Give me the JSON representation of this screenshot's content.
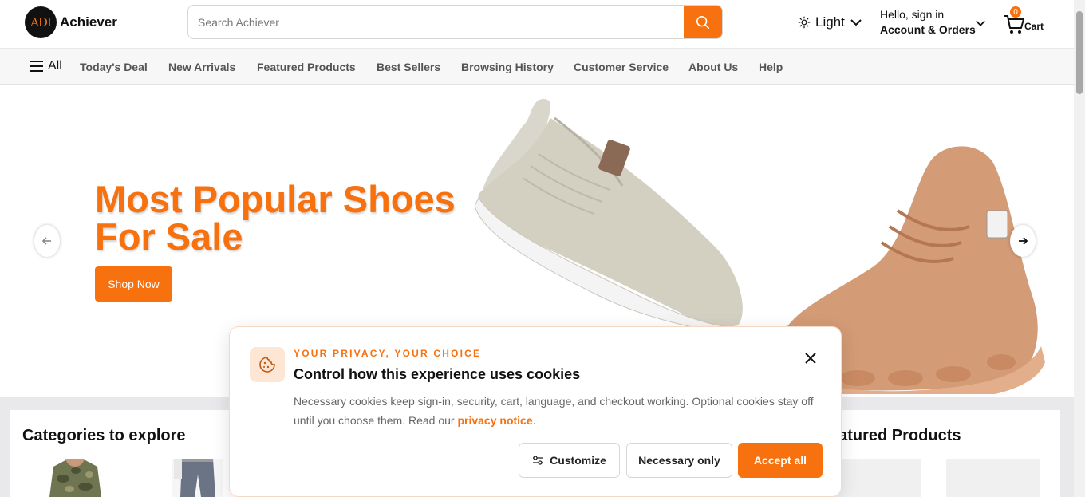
{
  "header": {
    "logo_text": "ADI",
    "brand": "Achiever",
    "search_placeholder": "Search Achiever",
    "theme_label": "Light",
    "account_greeting": "Hello, sign in",
    "account_label": "Account & Orders",
    "cart_count": "0",
    "cart_label": "Cart"
  },
  "nav": {
    "all_label": "All",
    "items": [
      "Today's Deal",
      "New Arrivals",
      "Featured Products",
      "Best Sellers",
      "Browsing History",
      "Customer Service",
      "About Us",
      "Help"
    ]
  },
  "hero": {
    "title": "Most Popular Shoes For Sale",
    "cta": "Shop Now"
  },
  "sections": {
    "categories_title": "Categories to explore",
    "featured_title": "eatured Products"
  },
  "cookie": {
    "eyebrow": "YOUR PRIVACY, YOUR CHOICE",
    "title": "Control how this experience uses cookies",
    "text": "Necessary cookies keep sign-in, security, cart, language, and checkout working. Optional cookies stay off until you choose them. Read our",
    "link": "privacy notice",
    "text_end": ".",
    "customize": "Customize",
    "necessary": "Necessary only",
    "accept": "Accept all"
  },
  "colors": {
    "accent": "#f7710f",
    "nav_bg": "#f7f7f7",
    "section_bg": "#e9e9ec"
  }
}
